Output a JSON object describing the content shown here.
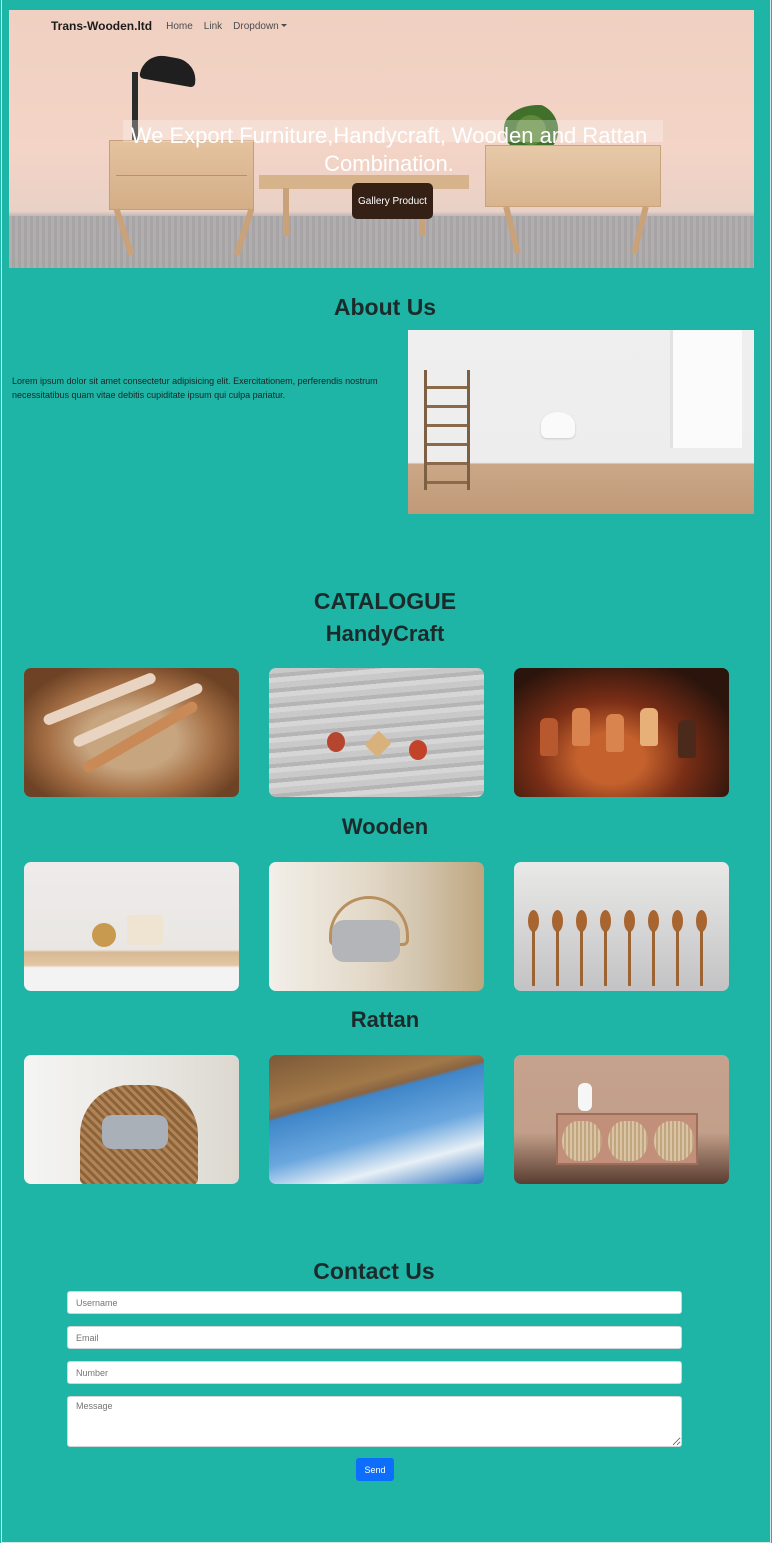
{
  "navbar": {
    "brand": "Trans-Wooden.ltd",
    "links": [
      "Home",
      "Link"
    ],
    "dropdown_label": "Dropdown"
  },
  "hero": {
    "title": "We Export Furniture,Handycraft, Wooden and Rattan Combination.",
    "button_label": "Gallery Product"
  },
  "about": {
    "heading": "About Us",
    "text": "Lorem ipsum dolor sit amet consectetur adipisicing elit. Exercitationem, perferendis nostrum necessitatibus quam vitae debitis cupiditate ipsum qui culpa pariatur."
  },
  "catalogue": {
    "heading": "CATALOGUE",
    "sections": [
      {
        "title": "HandyCraft"
      },
      {
        "title": "Wooden"
      },
      {
        "title": "Rattan"
      }
    ]
  },
  "contact": {
    "heading": "Contact Us",
    "fields": {
      "username_placeholder": "Username",
      "email_placeholder": "Email",
      "number_placeholder": "Number",
      "message_placeholder": "Message"
    },
    "send_label": "Send"
  },
  "colors": {
    "page_background": "#1fb5a6",
    "hero_button": "#352016",
    "send_button": "#0d6efd"
  }
}
